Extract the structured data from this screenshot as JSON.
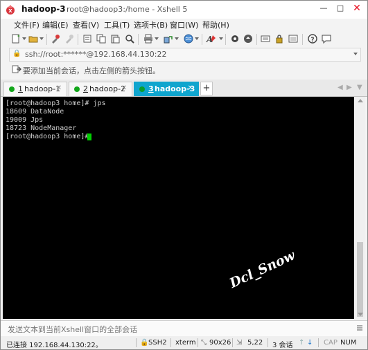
{
  "title": {
    "main": "hadoop-3",
    "sub": "root@hadoop3:/home - Xshell 5"
  },
  "window_controls": {
    "minimize": "—",
    "maximize": "□",
    "close": "✕"
  },
  "menu": [
    "文件(F)",
    "编辑(E)",
    "查看(V)",
    "工具(T)",
    "选项卡(B)",
    "窗口(W)",
    "帮助(H)"
  ],
  "address": {
    "value": "ssh://root:******@192.168.44.130:22"
  },
  "hint": {
    "text": "要添加当前会话，点击左侧的箭头按钮。"
  },
  "tabs": [
    {
      "num": "1",
      "label": "hadoop-1",
      "active": false
    },
    {
      "num": "2",
      "label": "hadoop-2",
      "active": false
    },
    {
      "num": "3",
      "label": "hadoop-3",
      "active": true
    }
  ],
  "tab_add": "+",
  "terminal": {
    "lines": [
      "[root@hadoop3 home]# jps",
      "18609 DataNode",
      "19009 Jps",
      "18723 NodeManager",
      "[root@hadoop3 home]# "
    ],
    "watermark": "Dcl_Snow"
  },
  "send_bar": {
    "text": "发送文本到当前Xshell窗口的全部会话"
  },
  "status": {
    "connection": "已连接 192.168.44.130:22。",
    "protocol": "SSH2",
    "terminal_type": "xterm",
    "size": "90x26",
    "cursor_pos": "5,22",
    "sessions": "3 会话",
    "caps": "CAP",
    "num": "NUM"
  },
  "colors": {
    "active_tab": "#0fa5ce",
    "terminal_bg": "#000000",
    "terminal_text": "#cfcfcf",
    "cursor": "#00d000",
    "session_dot": "#12a61a"
  }
}
